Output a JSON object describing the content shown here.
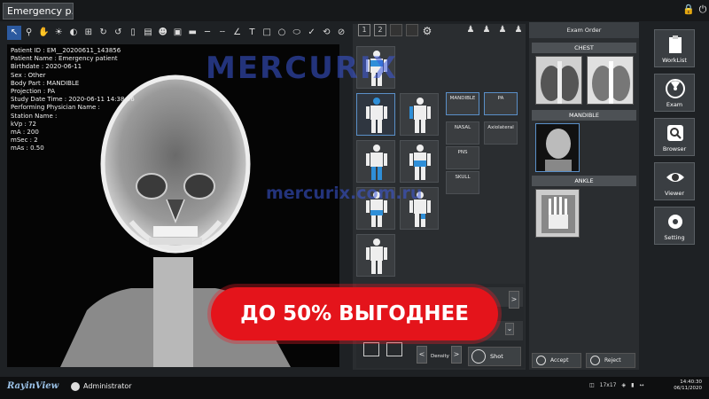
{
  "titlebar": {
    "tab_label": "Emergency p...",
    "lock_icon": "lock-icon",
    "power_icon": "power-icon"
  },
  "toolbar": {
    "tools": [
      "pointer",
      "zoom",
      "pan",
      "window-level",
      "invert",
      "crop",
      "rotate-cw",
      "rotate-ccw",
      "flip-vertical",
      "flip-horizontal",
      "annotate-user",
      "id-card",
      "shutter",
      "line",
      "horizontal-line",
      "angle",
      "text",
      "rectangle",
      "circle",
      "ellipse",
      "check",
      "undo",
      "reset"
    ]
  },
  "dicom": {
    "lines": [
      "Patient ID : EM__20200611_143856",
      "Patient Name : Emergency patient",
      "Birthdate : 2020-06-11",
      "Sex : Other",
      "Body Part : MANDIBLE",
      "Projection : PA",
      "Study Date Time : 2020-06-11 14:38:56",
      "Performing Physician Name :",
      "Station Name :",
      "kVp : 72",
      "mA : 200",
      "mSec : 2",
      "mAs : 0.50"
    ]
  },
  "bodypart": {
    "projections_col1": [
      "MANDIBLE",
      "NASAL",
      "PNS",
      "SKULL"
    ],
    "projections_col2": [
      "PA",
      "Axiolateral"
    ]
  },
  "controls": {
    "density_label": "Density",
    "shot_label": "Shot"
  },
  "exam": {
    "title": "Exam Order",
    "groups": [
      "CHEST",
      "MANDIBLE",
      "ANKLE"
    ],
    "accept": "Accept",
    "reject": "Reject"
  },
  "nav": {
    "items": [
      "WorkList",
      "Exam",
      "Browser",
      "Viewer",
      "Setting"
    ]
  },
  "status": {
    "brand": "RayinView",
    "user": "Administrator",
    "size": "17x17",
    "time": "14:40:30",
    "date": "06/11/2020"
  },
  "overlay": {
    "watermark_logo": "MERCURIX",
    "watermark_url": "mercurix.com.ru",
    "banner": "ДО 50% ВЫГОДНЕЕ"
  },
  "colors": {
    "accent": "#2c5aa0",
    "banner": "#e4141b",
    "bodypart_highlight": "#2f8fd8"
  }
}
